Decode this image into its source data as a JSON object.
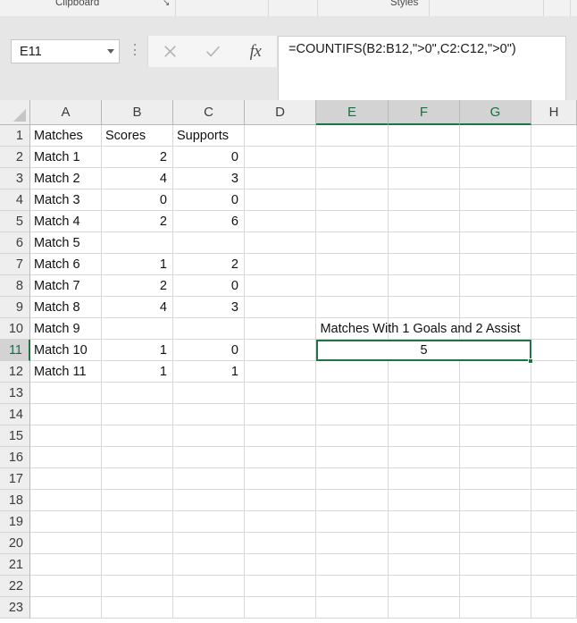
{
  "ribbon": {
    "groups": [
      {
        "name": "Clipboard",
        "label": "Clipboard"
      },
      {
        "name": "Styles",
        "label": "Styles"
      }
    ],
    "dialog_launcher_glyph": "↘"
  },
  "formula_bar": {
    "name_box_value": "E11",
    "cancel_label": "×",
    "enter_label": "✓",
    "insert_function_label": "fx",
    "formula": "=COUNTIFS(B2:B12,\">0\",C2:C12,\">0\")"
  },
  "grid": {
    "column_headers": [
      "A",
      "B",
      "C",
      "D",
      "E",
      "F",
      "G",
      "H"
    ],
    "selected_columns": [
      "E",
      "F",
      "G"
    ],
    "row_headers": [
      "1",
      "2",
      "3",
      "4",
      "5",
      "6",
      "7",
      "8",
      "9",
      "10",
      "11",
      "12",
      "13",
      "14",
      "15",
      "16",
      "17",
      "18",
      "19",
      "20",
      "21",
      "22",
      "23"
    ],
    "selected_row": "11",
    "active_cell": "E11",
    "columns": {
      "A": {
        "header": "Matches",
        "values": [
          "Match 1",
          "Match 2",
          "Match 3",
          "Match 4",
          "Match 5",
          "Match 6",
          "Match 7",
          "Match 8",
          "Match 9",
          "Match 10",
          "Match 11"
        ]
      },
      "B": {
        "header": "Scores",
        "values": [
          "2",
          "4",
          "0",
          "2",
          "",
          "1",
          "2",
          "4",
          "",
          "1",
          "1"
        ]
      },
      "C": {
        "header": "Supports",
        "values": [
          "0",
          "3",
          "0",
          "6",
          "",
          "2",
          "0",
          "3",
          "",
          "0",
          "1"
        ]
      }
    },
    "annotation": {
      "label_cell": "E10",
      "label_text": "Matches With 1 Goals and 2 Assist",
      "result_cell": "E11",
      "result_value": "5"
    }
  },
  "colors": {
    "accent_green": "#217346",
    "header_fill": "#eeeeee",
    "header_selected_fill": "#d3d3d3",
    "gridline": "#d8d8d8",
    "chrome_gray": "#e6e6e6"
  }
}
